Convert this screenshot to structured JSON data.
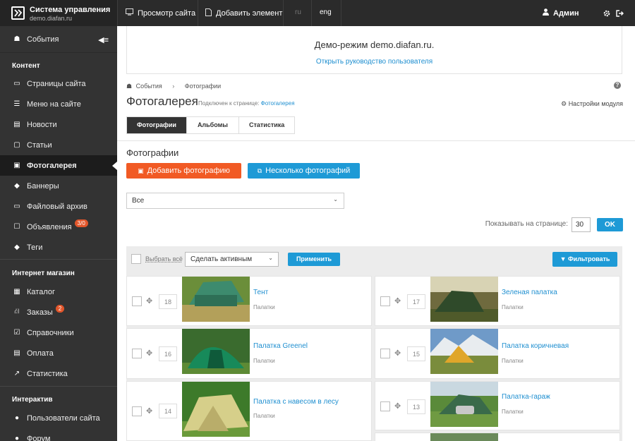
{
  "brand": {
    "title": "Система управления",
    "subtitle": "demo.diafan.ru"
  },
  "topnav": {
    "view_site": "Просмотр сайта",
    "add_element": "Добавить элемент",
    "lang_ru": "ru",
    "lang_en": "eng",
    "user": "Админ"
  },
  "sidebar": {
    "events": "События",
    "sections": [
      {
        "title": "Контент"
      },
      {
        "title": "Интернет магазин"
      },
      {
        "title": "Интерактив"
      }
    ],
    "items": [
      {
        "label": "Страницы сайта",
        "icon": "document-icon"
      },
      {
        "label": "Меню на сайте",
        "icon": "menu-icon"
      },
      {
        "label": "Новости",
        "icon": "news-icon"
      },
      {
        "label": "Статьи",
        "icon": "article-icon"
      },
      {
        "label": "Фотогалерея",
        "icon": "image-icon",
        "active": true
      },
      {
        "label": "Баннеры",
        "icon": "tag-icon"
      },
      {
        "label": "Файловый архив",
        "icon": "folder-icon"
      },
      {
        "label": "Объявления",
        "icon": "note-icon",
        "badge": "3/0"
      },
      {
        "label": "Теги",
        "icon": "tags-icon"
      },
      {
        "label": "Каталог",
        "icon": "grid-icon"
      },
      {
        "label": "Заказы",
        "icon": "cart-icon",
        "badge": "2"
      },
      {
        "label": "Справочники",
        "icon": "checkbox-icon"
      },
      {
        "label": "Оплата",
        "icon": "card-icon"
      },
      {
        "label": "Статистика",
        "icon": "chart-icon"
      },
      {
        "label": "Пользователи сайта",
        "icon": "users-icon"
      },
      {
        "label": "Форум",
        "icon": "forum-icon"
      }
    ]
  },
  "demo": {
    "title": "Демо-режим demo.diafan.ru.",
    "link": "Открыть руководство пользователя"
  },
  "breadcrumb": {
    "item1": "События",
    "item2": "Фотографии"
  },
  "page": {
    "title": "Фотогалерея",
    "connected_label": "Подключен к странице:",
    "connected_link": "Фотогалерея",
    "module_settings": "Настройки модуля"
  },
  "tabs": [
    "Фотографии",
    "Альбомы",
    "Статистика"
  ],
  "section_title": "Фотографии",
  "buttons": {
    "add_photo": "Добавить фотографию",
    "multi_photo": "Несколько фотографий",
    "ok": "OK",
    "apply": "Применить",
    "filter": "Фильтровать"
  },
  "album_select": {
    "value": "Все"
  },
  "per_page": {
    "label": "Показывать на странице:",
    "value": "30"
  },
  "bulk": {
    "select_all": "Выбрать всё",
    "action": "Сделать активным"
  },
  "photos": [
    {
      "num": "18",
      "name": "Тент",
      "category": "Палатки"
    },
    {
      "num": "17",
      "name": "Зеленая палатка",
      "category": "Палатки"
    },
    {
      "num": "16",
      "name": "Палатка Greenel",
      "category": "Палатки"
    },
    {
      "num": "15",
      "name": "Палатка коричневая",
      "category": "Палатки"
    },
    {
      "num": "14",
      "name": "Палатка с навесом в лесу",
      "category": "Палатки"
    },
    {
      "num": "13",
      "name": "Палатка-гараж",
      "category": "Палатки"
    }
  ],
  "colors": {
    "orange": "#f15a24",
    "blue": "#1e9ad6",
    "sidebar": "#333333",
    "topbar": "#2b2b2b"
  }
}
